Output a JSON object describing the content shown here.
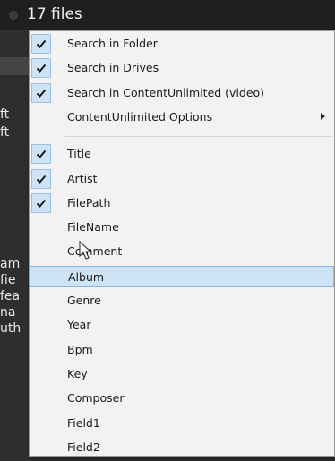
{
  "topbar": {
    "file_count": "17 files"
  },
  "background": {
    "fragments": [
      "ft",
      "ft",
      "am",
      "fie",
      "fea",
      "na",
      "uth"
    ]
  },
  "menu": {
    "group1": [
      {
        "label": "Search in Folder",
        "checked": true
      },
      {
        "label": "Search in Drives",
        "checked": true
      },
      {
        "label": "Search in ContentUnlimited (video)",
        "checked": true
      },
      {
        "label": "ContentUnlimited Options",
        "checked": false,
        "submenu": true
      }
    ],
    "group2": [
      {
        "label": "Title",
        "checked": true
      },
      {
        "label": "Artist",
        "checked": true
      },
      {
        "label": "FilePath",
        "checked": true
      },
      {
        "label": "FileName",
        "checked": false
      },
      {
        "label": "Comment",
        "checked": false
      },
      {
        "label": "Album",
        "checked": false,
        "hover": true
      },
      {
        "label": "Genre",
        "checked": false
      },
      {
        "label": "Year",
        "checked": false
      },
      {
        "label": "Bpm",
        "checked": false
      },
      {
        "label": "Key",
        "checked": false
      },
      {
        "label": "Composer",
        "checked": false
      },
      {
        "label": "Field1",
        "checked": false
      },
      {
        "label": "Field2",
        "checked": false
      }
    ]
  },
  "colors": {
    "check_bg": "#cfe3f7",
    "hover_bg": "#cde4f7",
    "menu_bg": "#f2f2f2"
  }
}
